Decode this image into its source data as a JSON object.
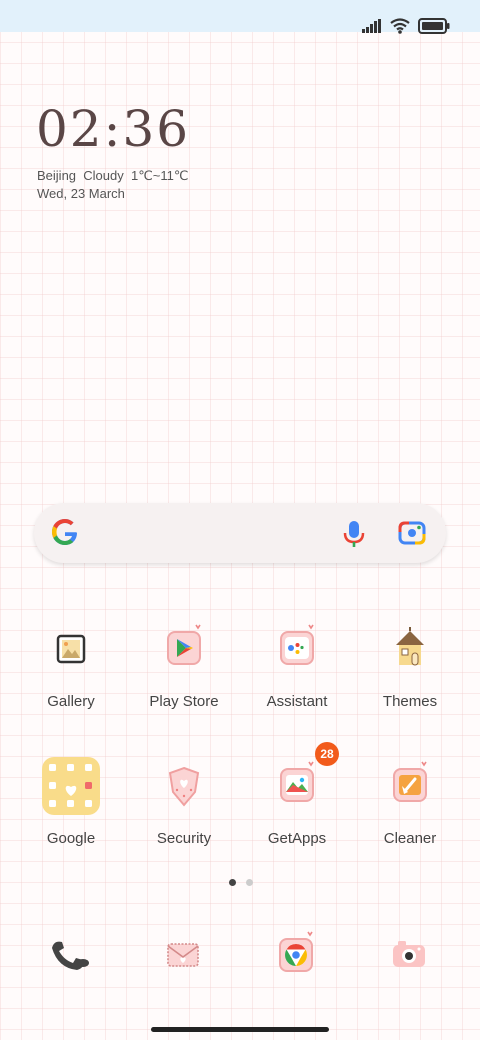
{
  "status_bar": {
    "signal_icon": "signal-icon",
    "wifi_icon": "wifi-icon",
    "battery_icon": "battery-icon"
  },
  "clock": {
    "time": "02:36"
  },
  "weather": {
    "city": "Beijing",
    "condition": "Cloudy",
    "temperature": "1℃~11℃"
  },
  "date": "Wed, 23 March",
  "search": {
    "logo_icon": "google-g-icon",
    "mic_icon": "microphone-icon",
    "lens_icon": "google-lens-icon"
  },
  "apps": [
    {
      "label": "Gallery",
      "icon": "gallery-icon"
    },
    {
      "label": "Play Store",
      "icon": "play-store-icon"
    },
    {
      "label": "Assistant",
      "icon": "assistant-icon"
    },
    {
      "label": "Themes",
      "icon": "themes-icon"
    },
    {
      "label": "Google",
      "icon": "google-folder-icon"
    },
    {
      "label": "Security",
      "icon": "security-icon"
    },
    {
      "label": "GetApps",
      "icon": "getapps-icon",
      "badge": "28"
    },
    {
      "label": "Cleaner",
      "icon": "cleaner-icon"
    }
  ],
  "pager": {
    "pages": 2,
    "active": 1
  },
  "dock": [
    {
      "icon": "phone-icon"
    },
    {
      "icon": "messages-icon"
    },
    {
      "icon": "chrome-icon"
    },
    {
      "icon": "camera-icon"
    }
  ],
  "colors": {
    "status_bar": "#e2f1fb",
    "clock": "#5a4646",
    "badge": "#f25b1b",
    "grid": "#f0c8c8"
  }
}
